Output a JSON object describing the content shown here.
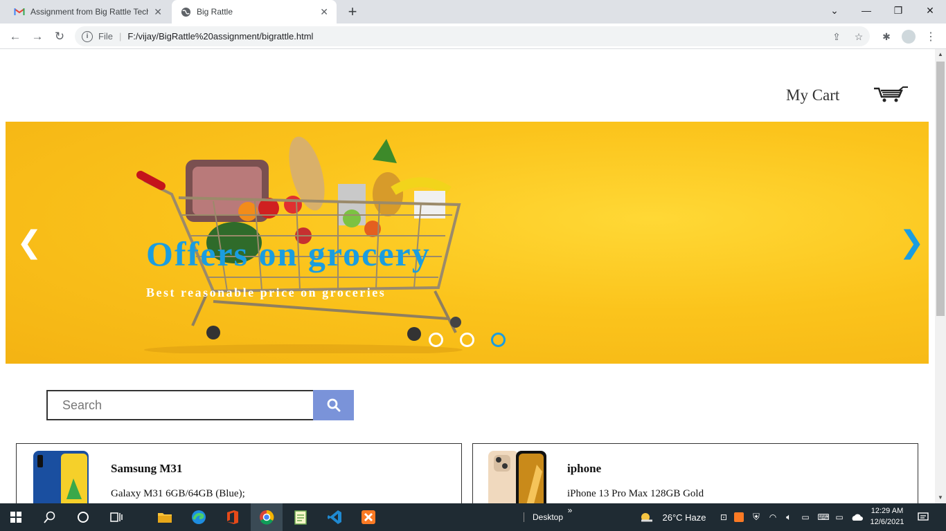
{
  "browser": {
    "tabs": [
      {
        "title": "Assignment from Big Rattle Technolog",
        "favicon": "gmail-icon",
        "active": false
      },
      {
        "title": "Big Rattle",
        "favicon": "globe-icon",
        "active": true
      }
    ],
    "new_tab_label": "+",
    "address": {
      "scheme": "File",
      "url": "F:/vijay/BigRattle%20assignment/bigrattle.html"
    }
  },
  "page": {
    "cart_label": "My Cart",
    "banner": {
      "title": "Offers on grocery",
      "subtitle": "Best reasonable price on groceries",
      "prev_arrow": "❮",
      "next_arrow": "❯",
      "slide_count": 3,
      "active_slide": 3
    },
    "search": {
      "placeholder": "Search"
    },
    "products": [
      {
        "name": "Samsung M31",
        "description": "Galaxy M31 6GB/64GB (Blue);",
        "image": "samsung-phone-icon"
      },
      {
        "name": "iphone",
        "description": "iPhone 13 Pro Max 128GB Gold",
        "image": "iphone-icon"
      }
    ]
  },
  "taskbar": {
    "desktop_label": "Desktop",
    "more_label": "»",
    "weather": "26°C  Haze",
    "time": "12:29 AM",
    "date": "12/6/2021",
    "apps": [
      "start-icon",
      "search-icon",
      "cortana-icon",
      "task-view-icon",
      "file-explorer-icon",
      "edge-icon",
      "office-icon",
      "chrome-icon",
      "notepad-icon",
      "vscode-icon",
      "xampp-icon"
    ]
  },
  "colors": {
    "accent_blue": "#1a9de0",
    "banner_yellow": "#fbc41c",
    "search_button": "#7a93d9"
  }
}
